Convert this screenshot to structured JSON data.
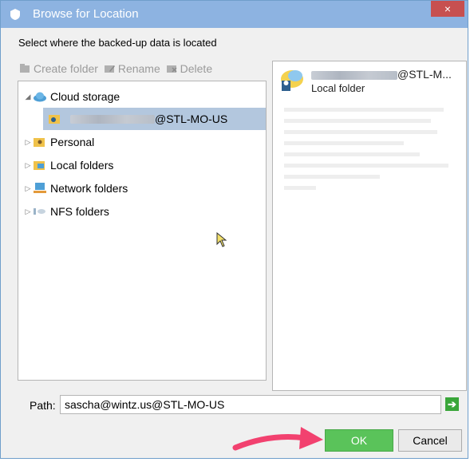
{
  "window": {
    "title": "Browse for Location",
    "close_glyph": "×"
  },
  "instruction": "Select where the backed-up data is located",
  "toolbar": {
    "create_label": "Create folder",
    "rename_label": "Rename",
    "delete_label": "Delete"
  },
  "tree": {
    "root_label": "Cloud storage",
    "selected_suffix": "@STL-MO-US",
    "items": [
      "Personal",
      "Local folders",
      "Network folders",
      "NFS folders"
    ]
  },
  "details": {
    "name_suffix": "@STL-M...",
    "type": "Local folder"
  },
  "path": {
    "label": "Path:",
    "value": "sascha@wintz.us@STL-MO-US"
  },
  "buttons": {
    "ok": "OK",
    "cancel": "Cancel"
  },
  "icons": {
    "app": "shield-icon",
    "close": "close-icon",
    "go": "arrow-right-icon",
    "cloud": "cloud-icon",
    "account": "user-folder-icon",
    "personal": "personal-folder-icon",
    "local": "local-folder-icon",
    "network": "network-folder-icon",
    "nfs": "nfs-icon"
  },
  "colors": {
    "titlebar": "#8db3e1",
    "selection": "#b3c7de",
    "ok": "#5ac35a",
    "close": "#c75050",
    "annotation": "#f2416f"
  }
}
